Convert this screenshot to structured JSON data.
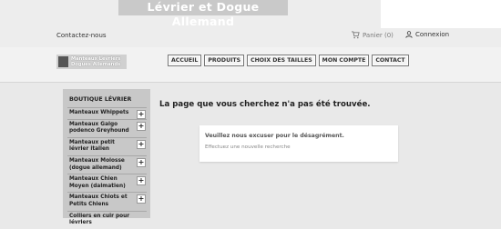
{
  "topbar": {
    "banner_title": "Lévrier et Dogue Allemand",
    "contact_label": "Contactez-nous",
    "cart_label": "Panier (0)",
    "connexion_label": "Connexion"
  },
  "header": {
    "logo_line1": "Manteaux Lévriers",
    "logo_line2": "Dogues Allemands",
    "nav": [
      "ACCUEIL",
      "PRODUITS",
      "CHOIX DES TAILLES",
      "MON COMPTE",
      "CONTACT"
    ]
  },
  "sidebar": {
    "title": "BOUTIQUE LÉVRIER",
    "items": [
      "Manteaux Whippets",
      "Manteaux Galgo podenco Greyhound",
      "Manteaux petit lévrier italien",
      "Manteaux Molosse (dogue allemand)",
      "Manteaux Chien Moyen (dalmatien)",
      "Manteaux Chiots et Petits Chiens",
      "Colliers en cuir pour lévriers"
    ]
  },
  "main": {
    "title": "La page que vous cherchez n'a pas été trouvée.",
    "sorry": "Veuillez nous excuser pour le désagrément.",
    "search_text": "Effectuez une nouvelle recherche"
  }
}
